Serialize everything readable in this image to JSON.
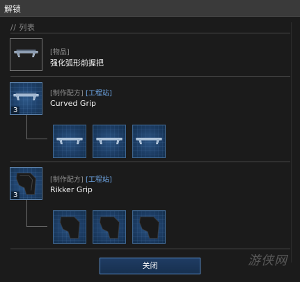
{
  "window": {
    "title": "解锁"
  },
  "list": {
    "header": "// 列表"
  },
  "item": {
    "category": "[物品]",
    "name": "强化弧形前握把"
  },
  "recipes": [
    {
      "tag": "[制作配方]",
      "station": "[工程站]",
      "name": "Curved Grip",
      "count": "3",
      "material_icon": "curved-grip-icon",
      "material_count": 3
    },
    {
      "tag": "[制作配方]",
      "station": "[工程站]",
      "name": "Rikker Grip",
      "count": "3",
      "material_icon": "rikker-grip-icon",
      "material_count": 3
    }
  ],
  "footer": {
    "close_label": "关闭"
  },
  "watermark": {
    "text": "游侠网"
  },
  "colors": {
    "accent": "#5b93d6",
    "station": "#6fa8e8",
    "slot_blue": "#1e416b"
  }
}
